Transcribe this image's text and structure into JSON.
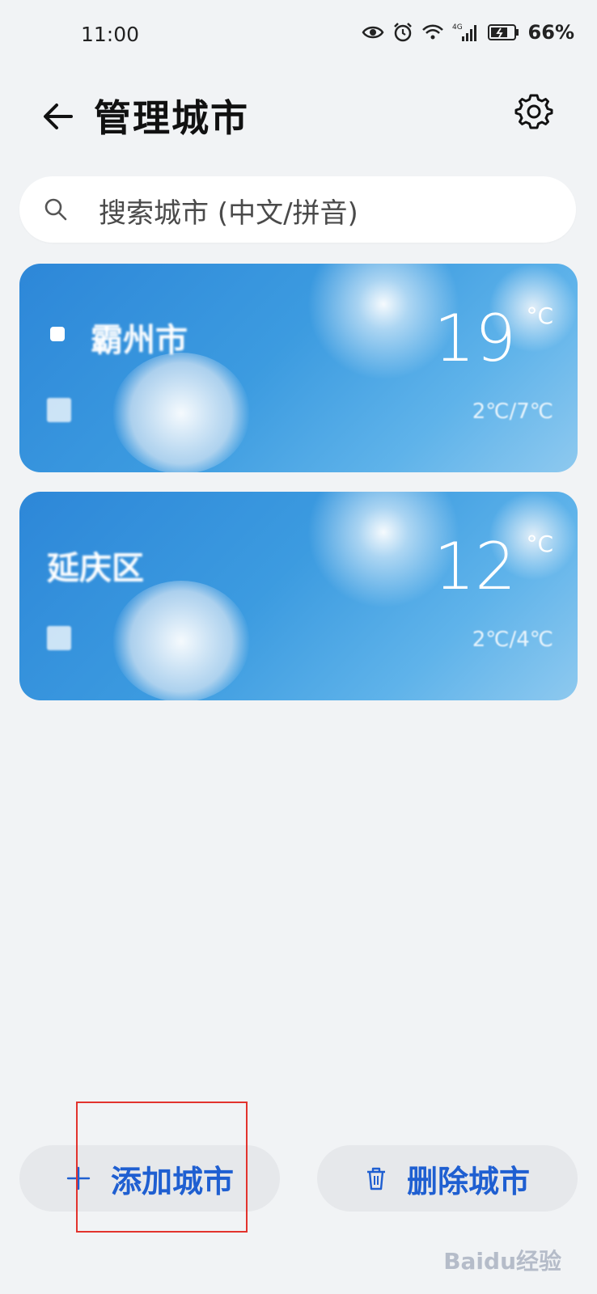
{
  "status_bar": {
    "time": "11:00",
    "battery_percent": "66%",
    "network": "4G"
  },
  "header": {
    "title": "管理城市"
  },
  "search": {
    "placeholder": "搜索城市 (中文/拼音)"
  },
  "cities": [
    {
      "name": "霸州市",
      "temperature": "19",
      "unit": "°C",
      "range": "2℃/7℃",
      "is_current_location": true
    },
    {
      "name": "延庆区",
      "temperature": "12",
      "unit": "°C",
      "range": "2℃/4℃",
      "is_current_location": false
    }
  ],
  "actions": {
    "add_label": "添加城市",
    "delete_label": "删除城市"
  },
  "watermark": "Baidu经验",
  "colors": {
    "accent": "#1f5fd1",
    "highlight": "#e2332d",
    "background": "#f1f3f5",
    "button_bg": "#e6e8eb"
  },
  "icons": [
    "eye-icon",
    "alarm-icon",
    "wifi-icon",
    "signal-icon",
    "battery-icon",
    "back-arrow-icon",
    "settings-gear-icon",
    "search-icon",
    "location-icon",
    "weather-icon",
    "plus-icon",
    "trash-icon"
  ]
}
